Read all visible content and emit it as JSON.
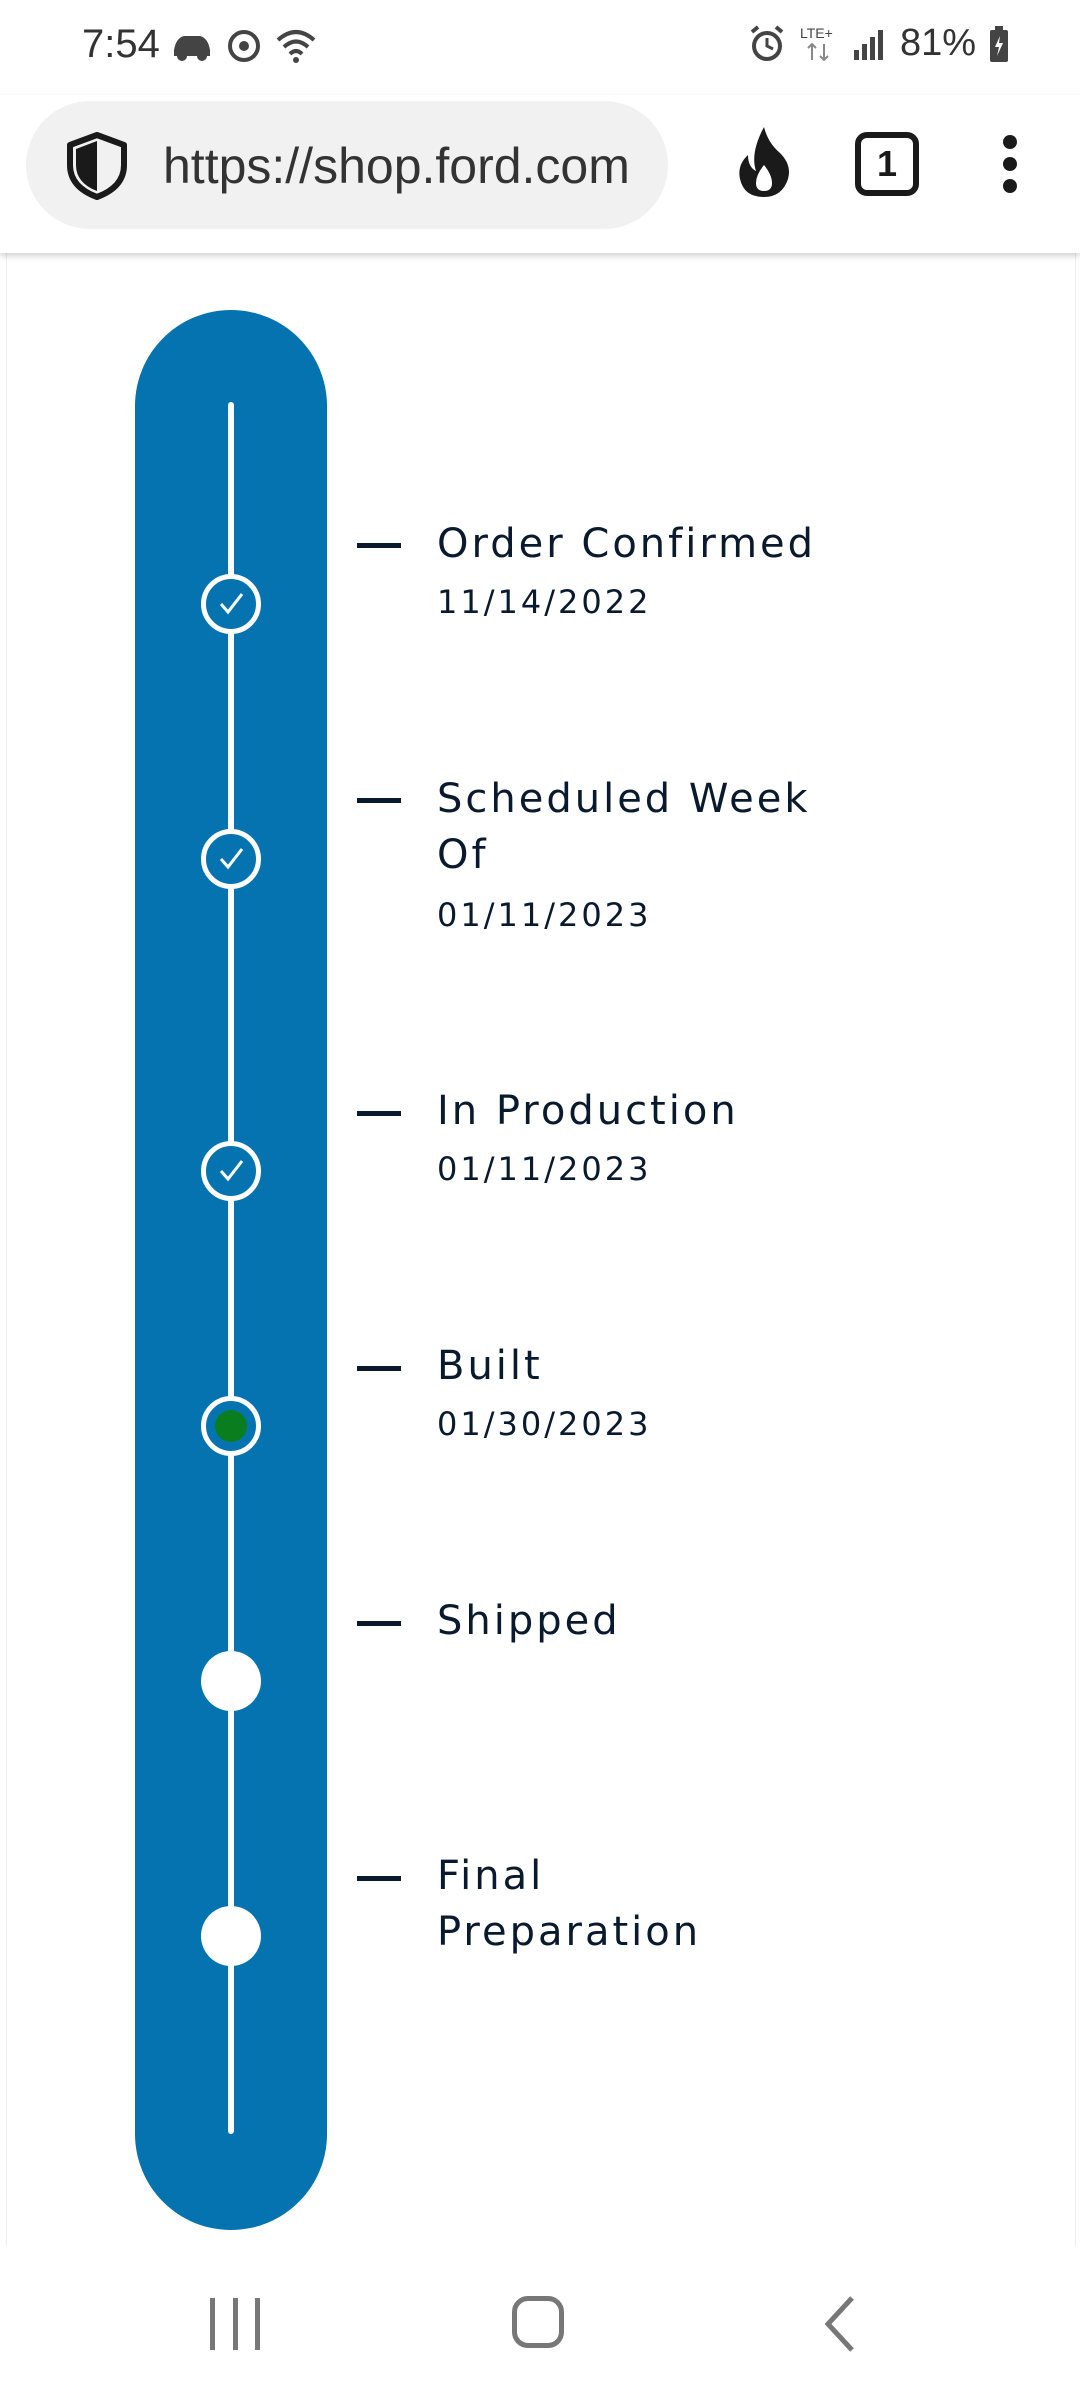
{
  "status_bar": {
    "time": "7:54",
    "battery": "81%",
    "network": "LTE+",
    "icons_left": [
      "car-icon",
      "sync-icon",
      "wifi-icon"
    ],
    "icons_right": [
      "alarm-icon",
      "lte-icon",
      "signal-icon",
      "battery-icon"
    ]
  },
  "browser": {
    "url": "https://shop.ford.com",
    "tab_count": "1",
    "icons": [
      "shield-icon",
      "fire-icon",
      "tabs-icon",
      "menu-icon"
    ]
  },
  "timeline": {
    "accent_color": "#0673b1",
    "current_color": "#0a7d1e",
    "steps": [
      {
        "title": "Order Confirmed",
        "date": "11/14/2022",
        "status": "done"
      },
      {
        "title": "Scheduled Week Of",
        "date": "01/11/2023",
        "status": "done"
      },
      {
        "title": "In Production",
        "date": "01/11/2023",
        "status": "done"
      },
      {
        "title": "Built",
        "date": "01/30/2023",
        "status": "current"
      },
      {
        "title": "Shipped",
        "date": "",
        "status": "pending"
      },
      {
        "title": "Final Preparation",
        "date": "",
        "status": "pending"
      }
    ]
  },
  "nav_bar": {
    "icons": [
      "recents-icon",
      "home-icon",
      "back-icon"
    ]
  }
}
